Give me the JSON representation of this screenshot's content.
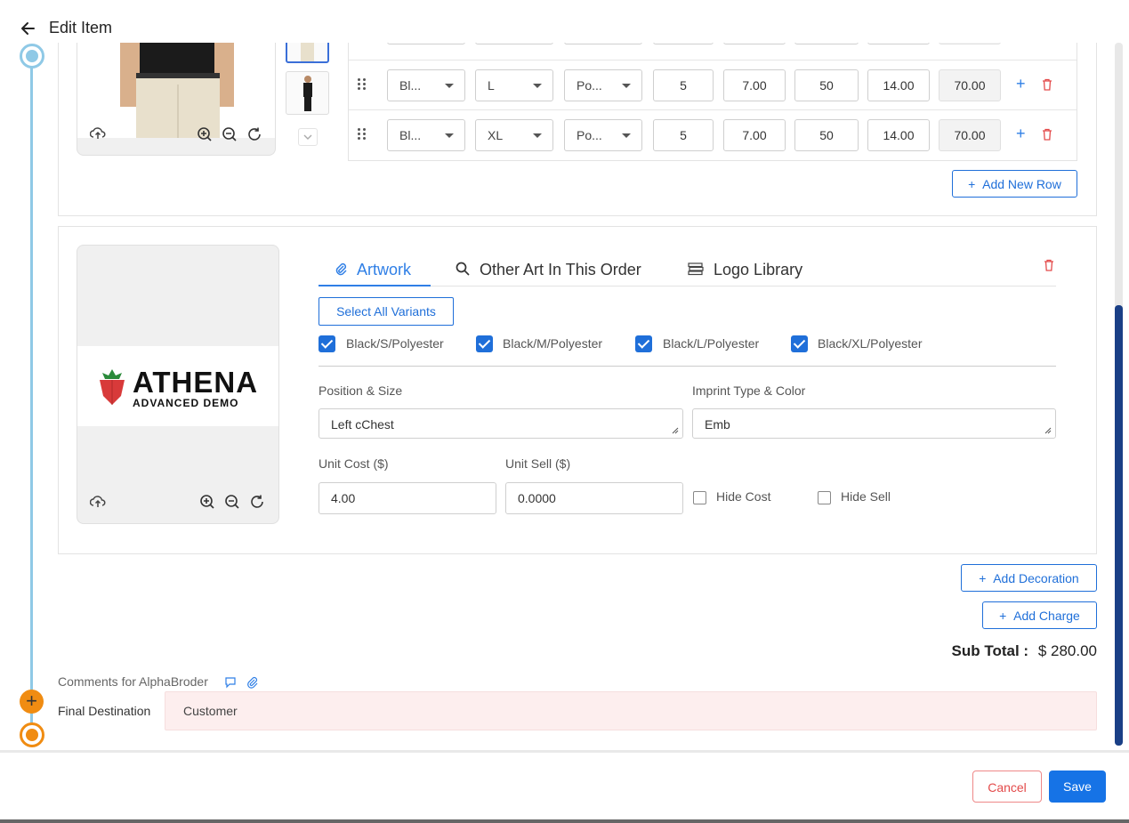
{
  "header": {
    "title": "Edit Item"
  },
  "variants": {
    "rows": [
      {
        "color": "Bl...",
        "size": "L",
        "material": "Po...",
        "qty": "5",
        "cost": "7.00",
        "margin": "50",
        "price": "14.00",
        "total": "70.00"
      },
      {
        "color": "Bl...",
        "size": "XL",
        "material": "Po...",
        "qty": "5",
        "cost": "7.00",
        "margin": "50",
        "price": "14.00",
        "total": "70.00"
      }
    ],
    "add_row_label": "Add New Row"
  },
  "decoration": {
    "tabs": [
      "Artwork",
      "Other Art In This Order",
      "Logo Library"
    ],
    "select_all_label": "Select All Variants",
    "variant_checks": [
      "Black/S/Polyester",
      "Black/M/Polyester",
      "Black/L/Polyester",
      "Black/XL/Polyester"
    ],
    "position_label": "Position & Size",
    "position_value": "Left cChest",
    "imprint_label": "Imprint Type & Color",
    "imprint_value": "Emb",
    "unit_cost_label": "Unit Cost ($)",
    "unit_cost_value": "4.00",
    "unit_sell_label": "Unit Sell ($)",
    "unit_sell_value": "0.0000",
    "hide_cost_label": "Hide Cost",
    "hide_sell_label": "Hide Sell",
    "logo_main": "ATHENA",
    "logo_sub": "ADVANCED DEMO"
  },
  "actions": {
    "add_decoration": "Add Decoration",
    "add_charge": "Add Charge",
    "subtotal_label": "Sub Total :",
    "subtotal_value": "$ 280.00"
  },
  "comments": {
    "label": "Comments for AlphaBroder",
    "final_destination_label": "Final Destination",
    "final_destination_value": "Customer"
  },
  "footer": {
    "cancel": "Cancel",
    "save": "Save"
  },
  "colors": {
    "accent": "#1f6fd9",
    "timeline_blue": "#8fc9e6",
    "timeline_orange": "#f08c12",
    "danger": "#e34a4a"
  }
}
